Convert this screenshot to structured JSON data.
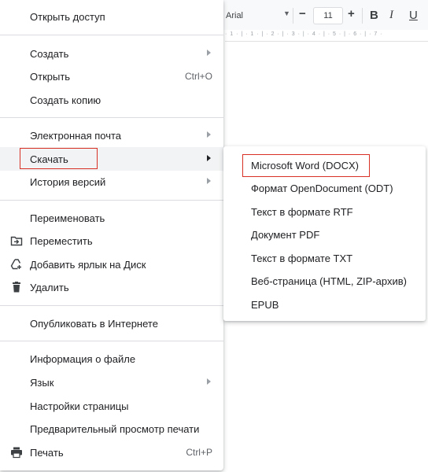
{
  "toolbar": {
    "font_name": "Arial",
    "font_size": "11",
    "minus": "−",
    "plus": "+",
    "bold": "B",
    "italic": "I",
    "underline": "U",
    "ruler": "· 1 · | · 1 · | · 2 · | · 3 · | · 4 · | · 5 · | · 6 · | · 7 ·"
  },
  "menu": {
    "share": "Открыть доступ",
    "create": "Создать",
    "open": "Открыть",
    "open_shortcut": "Ctrl+O",
    "copy": "Создать копию",
    "email": "Электронная почта",
    "download": "Скачать",
    "history": "История версий",
    "rename": "Переименовать",
    "move": "Переместить",
    "shortcut_drive": "Добавить ярлык на Диск",
    "delete": "Удалить",
    "publish": "Опубликовать в Интернете",
    "file_info": "Информация о файле",
    "language": "Язык",
    "page_setup": "Настройки страницы",
    "print_preview": "Предварительный просмотр печати",
    "print": "Печать",
    "print_shortcut": "Ctrl+P"
  },
  "download_submenu": {
    "items": [
      "Microsoft Word (DOCX)",
      "Формат OpenDocument (ODT)",
      "Текст в формате RTF",
      "Документ PDF",
      "Текст в формате TXT",
      "Веб-страница (HTML, ZIP-архив)",
      "EPUB"
    ]
  },
  "colors": {
    "highlight_border": "#d93025",
    "hover_bg": "#f1f3f4",
    "divider": "#dadce0"
  },
  "icons": {
    "move": "folder-move-icon",
    "shortcut_drive": "drive-shortcut-icon",
    "delete": "trash-icon",
    "print": "printer-icon"
  }
}
